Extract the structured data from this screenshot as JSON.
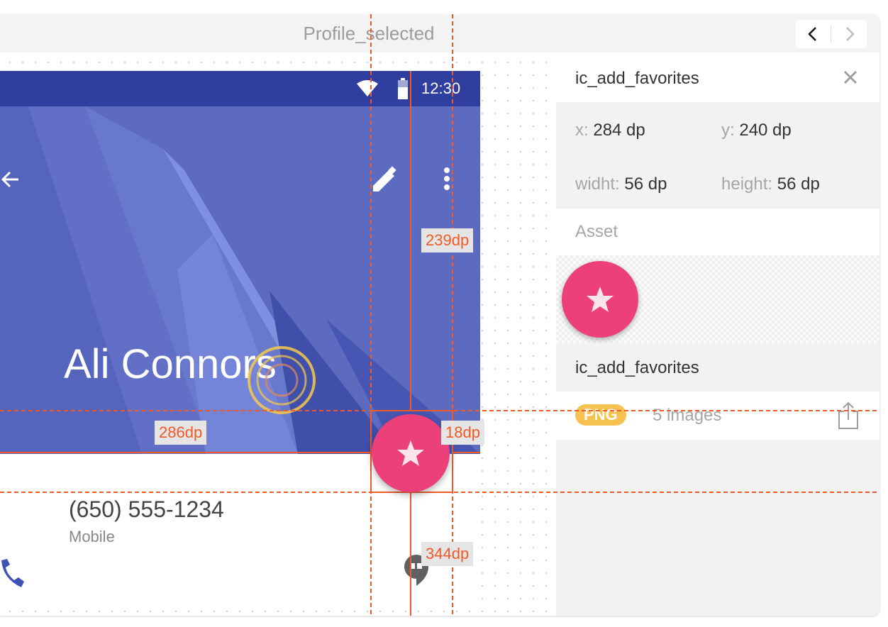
{
  "window": {
    "title": "Profile_selected"
  },
  "nav": {
    "prev_icon": "chevron-left-icon",
    "next_icon": "chevron-right-icon"
  },
  "phone": {
    "status_time": "12:30",
    "contact_name": "Ali Connors",
    "phone_number": "(650) 555-1234",
    "phone_type": "Mobile",
    "header_color": "#5c6bc0",
    "status_color": "#303f9f",
    "fab_color": "#ec407a"
  },
  "measurements": {
    "top": "239dp",
    "left": "286dp",
    "right": "18dp",
    "bottom": "344dp",
    "guide_color": "#f05a28"
  },
  "panel": {
    "title": "ic_add_favorites",
    "x_label": "x:",
    "x_value": "284 dp",
    "y_label": "y:",
    "y_value": "240 dp",
    "width_label": "widht:",
    "width_value": "56 dp",
    "height_label": "height:",
    "height_value": "56 dp",
    "asset_label": "Asset",
    "asset_name": "ic_add_favorites",
    "format_badge": "PNG",
    "image_count": "5 images",
    "badge_color": "#f5c150"
  }
}
